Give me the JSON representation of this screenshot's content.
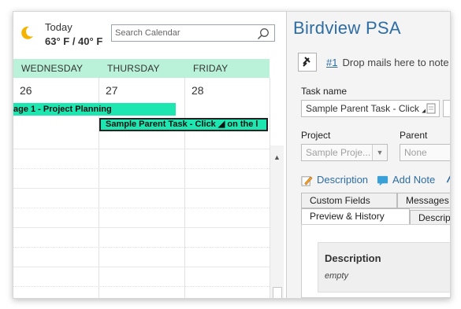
{
  "calendar": {
    "weather": {
      "today_label": "Today",
      "temps": "63° F / 40° F"
    },
    "search": {
      "placeholder": "Search Calendar"
    },
    "days": [
      "WEDNESDAY",
      "THURSDAY",
      "FRIDAY"
    ],
    "dates": [
      "26",
      "27",
      "28"
    ],
    "events": [
      {
        "label": "age 1 - Project Planning"
      },
      {
        "label": "Sample Parent Task - Click ◢ on the l"
      }
    ],
    "colors": {
      "header_bg": "#b9f2d9",
      "event_bg": "#1ee6b0"
    }
  },
  "task_pane": {
    "title": "Birdview PSA",
    "drop_hint": {
      "number": "#1",
      "text": "Drop mails here to note it"
    },
    "task_name_label": "Task name",
    "task_name_value": "Sample Parent Task - Click ◢",
    "project_label": "Project",
    "project_value": "Sample Proje...",
    "parent_label": "Parent",
    "parent_value": "None",
    "actions": {
      "description": "Description",
      "add_note": "Add Note"
    },
    "tabs": [
      "Custom Fields",
      "Messages",
      "Preview & History",
      "Descrip"
    ],
    "description_section": {
      "title": "Description",
      "value": "empty"
    },
    "colors": {
      "title": "#2e6da4"
    }
  }
}
